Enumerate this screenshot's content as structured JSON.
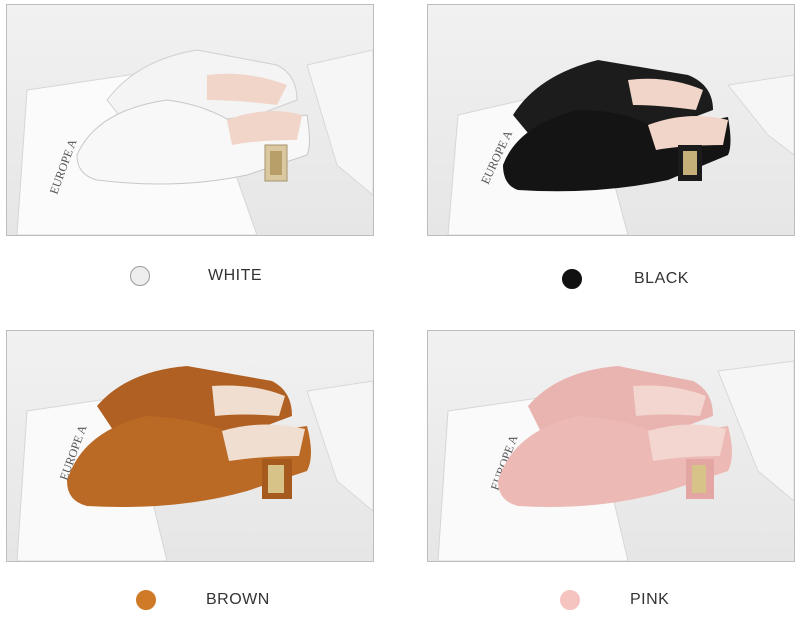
{
  "variants": [
    {
      "label": "WHITE",
      "color": "#f7f7f7",
      "swatch": "#eeeeee",
      "swatch_border": "#9a9a9a",
      "text_prefix": "'"
    },
    {
      "label": "BLACK",
      "color": "#1a1a1a",
      "swatch": "#111111",
      "swatch_border": "#111111",
      "text_prefix": "'"
    },
    {
      "label": "BROWN",
      "color": "#b5651d",
      "swatch": "#cf7a26",
      "swatch_border": "#cf7a26",
      "text_prefix": ""
    },
    {
      "label": "PINK",
      "color": "#eab0ad",
      "swatch": "#f5c4c0",
      "swatch_border": "#f5c4c0",
      "text_prefix": ""
    }
  ],
  "paper_text": "EUROPE A"
}
